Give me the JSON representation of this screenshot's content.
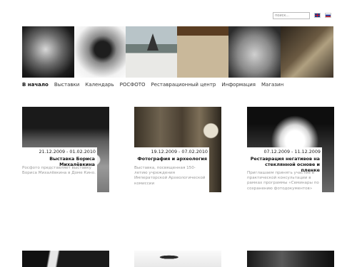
{
  "header": {
    "search_placeholder": "поиск...",
    "languages": [
      "english-flag-icon",
      "russian-flag-icon"
    ]
  },
  "nav": {
    "items": [
      "В начало",
      "Выставки",
      "Календарь",
      "РОСФОТО",
      "Реставрационный центр",
      "Информация",
      "Магазин"
    ]
  },
  "cards": [
    {
      "date": "21.12.2009 - 01.02.2010",
      "title": "Выставка Бориса Михалёвкина",
      "desc": "Росфото представляет выставку Бориса Михалёвкина в Доме Кино."
    },
    {
      "date": "19.12.2009 - 07.02.2010",
      "title": "Фотография и археология",
      "desc": "Выставка, посвященная 150-летию учреждения Императорской Археологической комиссии"
    },
    {
      "date": "07.12.2009 - 11.12.2009",
      "title": "Реставрация негативов на стеклянной основе и пленке",
      "desc": "Приглашаем принять участие в практической консультации в рамках программы «Семинары по сохранению фотодокументов»"
    }
  ],
  "colors": {
    "text": "#222222",
    "muted": "#999999",
    "background": "#ffffff"
  }
}
